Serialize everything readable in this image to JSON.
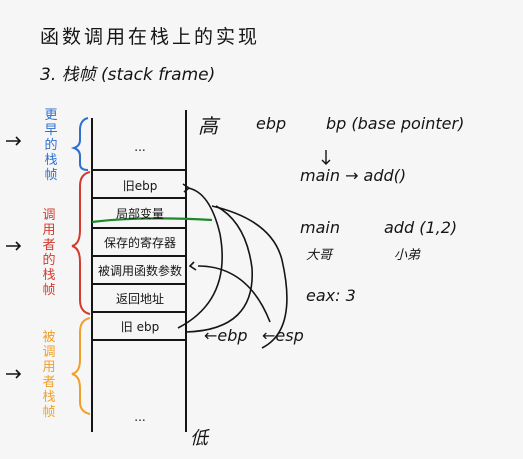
{
  "title": "函数调用在栈上的实现",
  "subtitle": "3. 栈帧 (stack frame)",
  "labels": {
    "high": "高",
    "low": "低",
    "ebp_header": "ebp",
    "bp_note": "bp (base pointer)",
    "main_to_add": "main → add()",
    "main": "main",
    "add_call": "add (1,2)",
    "big_brother": "大哥",
    "little_brother": "小弟",
    "eax": "eax: 3",
    "ebp_arrow": "←ebp",
    "esp_arrow": "←esp"
  },
  "side_labels": {
    "earlier_frame": "更早的栈帧",
    "caller_frame": "调用者的栈帧",
    "callee_frame": "被调用者栈帧"
  },
  "stack_cells": [
    {
      "text": "..."
    },
    {
      "text": "旧ebp"
    },
    {
      "text": "局部变量"
    },
    {
      "text": "保存的寄存器"
    },
    {
      "text": "被调用函数参数"
    },
    {
      "text": "返回地址"
    },
    {
      "text": "旧 ebp"
    },
    {
      "text": "..."
    }
  ],
  "colors": {
    "ink": "#151515",
    "blue": "#2f6fd0",
    "red": "#d23a2e",
    "orange": "#f0a02a",
    "green": "#1d8a2a"
  }
}
